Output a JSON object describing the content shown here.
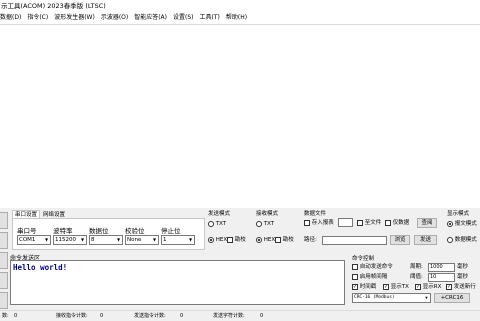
{
  "window": {
    "title": "示工具(ACOM) 2023春季版 (LTSC)"
  },
  "menu": [
    "数据(D)",
    "指令(C)",
    "波形发生器(W)",
    "示波器(O)",
    "智能应答(A)",
    "设置(S)",
    "工具(T)",
    "帮助(H)"
  ],
  "tabs": {
    "serial": "串口设置",
    "network": "网络设置"
  },
  "port_settings": {
    "labels": {
      "port": "串口号",
      "baud": "波特率",
      "databits": "数据位",
      "parity": "校验位",
      "stopbits": "停止位"
    },
    "values": {
      "port": "COM1",
      "baud": "115200",
      "databits": "8",
      "parity": "None",
      "stopbits": "1"
    }
  },
  "send_mode": {
    "title": "发送模式",
    "txt": "TXT",
    "hex": "HEX",
    "checksum": "勘校",
    "selected": "HEX"
  },
  "recv_mode": {
    "title": "接收模式",
    "txt": "TXT",
    "hex": "HEX",
    "checksum": "勘校",
    "selected": "HEX"
  },
  "data_file": {
    "title": "数据文件",
    "save_report": "存入报表",
    "to_file": "至文件",
    "data_only": "仅数据",
    "browse_top": "查阅",
    "path_label": "路径:",
    "browse": "浏览",
    "send": "发送"
  },
  "display_mode": {
    "title": "显示模式",
    "message": "报文模式",
    "data": "数据模式",
    "selected": "报文模式"
  },
  "command_send": {
    "label": "命令发送区",
    "content": "Hello world!"
  },
  "command_control": {
    "title": "命令控制",
    "auto_send": "自动发送命令",
    "period_label": "周期:",
    "period_value": "1000",
    "period_unit": "毫秒",
    "frame_break": "启用帧间隔",
    "threshold_label": "阈值:",
    "threshold_value": "10",
    "threshold_unit": "毫秒",
    "timestamp": "时间戳",
    "show_tx": "显示TX",
    "show_rx": "显示RX",
    "send_newline": "发送新行",
    "crc_value": "CRC-16 (Modbus)",
    "crc_button": "+CRC16"
  },
  "status": {
    "port_count_label": "数:",
    "port_count": "0",
    "recv_cmd_label": "接收指令计数:",
    "recv_cmd": "0",
    "send_cmd_label": "发送指令计数:",
    "send_cmd": "0",
    "send_bytes_label": "发送字符计数:",
    "send_bytes": "0"
  }
}
